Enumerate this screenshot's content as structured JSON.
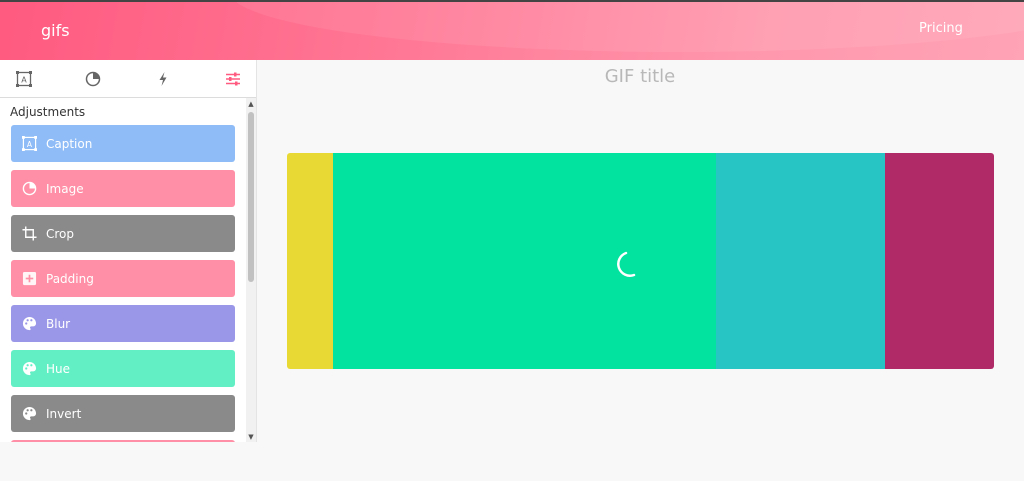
{
  "header": {
    "brand": "gifs",
    "pricing_label": "Pricing"
  },
  "sidebar": {
    "tabs": [
      {
        "name": "caption-tab",
        "icon": "caption-icon"
      },
      {
        "name": "image-tab",
        "icon": "pie-icon"
      },
      {
        "name": "effects-tab",
        "icon": "bolt-icon"
      },
      {
        "name": "adjustments-tab",
        "icon": "sliders-icon",
        "active": true
      }
    ],
    "section_title": "Adjustments",
    "items": [
      {
        "label": "Caption",
        "color": "#8fbcf6",
        "icon": "caption-icon"
      },
      {
        "label": "Image",
        "color": "#ff8fa6",
        "icon": "pie-icon"
      },
      {
        "label": "Crop",
        "color": "#8a8a8a",
        "icon": "crop-icon"
      },
      {
        "label": "Padding",
        "color": "#ff8fa6",
        "icon": "plus-square-icon"
      },
      {
        "label": "Blur",
        "color": "#9b97e8",
        "icon": "palette-icon"
      },
      {
        "label": "Hue",
        "color": "#63efc4",
        "icon": "palette-icon"
      },
      {
        "label": "Invert",
        "color": "#8a8a8a",
        "icon": "palette-icon"
      }
    ]
  },
  "main": {
    "gif_title": "GIF title",
    "preview_colors": [
      "#e8d935",
      "#02e39f",
      "#27c5c3",
      "#b02a68"
    ]
  },
  "colors": {
    "accent": "#ff5a80",
    "active_tab": "#ff5a80"
  }
}
